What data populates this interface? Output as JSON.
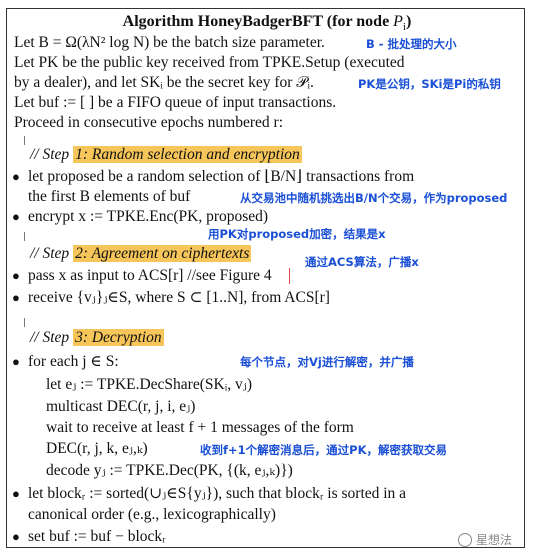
{
  "algorithm": {
    "title": "Algorithm HoneyBadgerBFT (for node ",
    "title_var": "P",
    "title_sub": "i",
    "title_close": ")",
    "intro": [
      "Let B = Ω(λN² log N) be the batch size parameter.",
      "Let PK be the public key received from TPKE.Setup (executed",
      "by a dealer), and let SKᵢ be the secret key for 𝒫ᵢ.",
      "Let buf := [ ] be a FIFO queue of input transactions.",
      "Proceed in consecutive epochs numbered r:"
    ],
    "steps": [
      {
        "prefix": "// Step ",
        "label": "1: Random selection and encryption",
        "lines": [
          "let proposed be a random selection of ⌊B/N⌋ transactions from",
          "the first B elements of buf",
          "encrypt x := TPKE.Enc(PK, proposed)"
        ]
      },
      {
        "prefix": "// Step ",
        "label": "2: Agreement on ciphertexts",
        "lines": [
          "pass x as input to ACS[r] //see Figure 4",
          "receive {vⱼ}ⱼ∈S, where S ⊂ [1..N], from ACS[r]"
        ]
      },
      {
        "prefix": "// Step ",
        "label": "3: Decryption",
        "lines": [
          "for each j ∈ S:",
          "let eⱼ := TPKE.DecShare(SKᵢ, vⱼ)",
          "multicast DEC(r, j, i, eⱼ)",
          "wait to receive at least f + 1 messages of the form",
          "DEC(r, j, k, eⱼ,ₖ)",
          "decode yⱼ := TPKE.Dec(PK, {(k, eⱼ,ₖ)})",
          "let blockᵣ := sorted(∪ⱼ∈S{yⱼ}), such that blockᵣ is sorted in a",
          "canonical order (e.g., lexicographically)",
          "set buf := buf − blockᵣ"
        ]
      }
    ]
  },
  "annotations": {
    "batch_size": "B - 批处理的大小",
    "keys": "PK是公钥，SKi是Pi的私钥",
    "random_select": "从交易池中随机挑选出B/N个交易，作为proposed",
    "encrypt": "用PK对proposed加密，结果是x",
    "acs": "通过ACS算法，广播x",
    "decrypt_share": "每个节点，对Vj进行解密，并广播",
    "decode": "收到f+1个解密消息后，通过PK，解密获取交易"
  },
  "watermark": "星想法",
  "colors": {
    "annotation": "#1a4fd6",
    "highlight": "#f7c65a"
  }
}
